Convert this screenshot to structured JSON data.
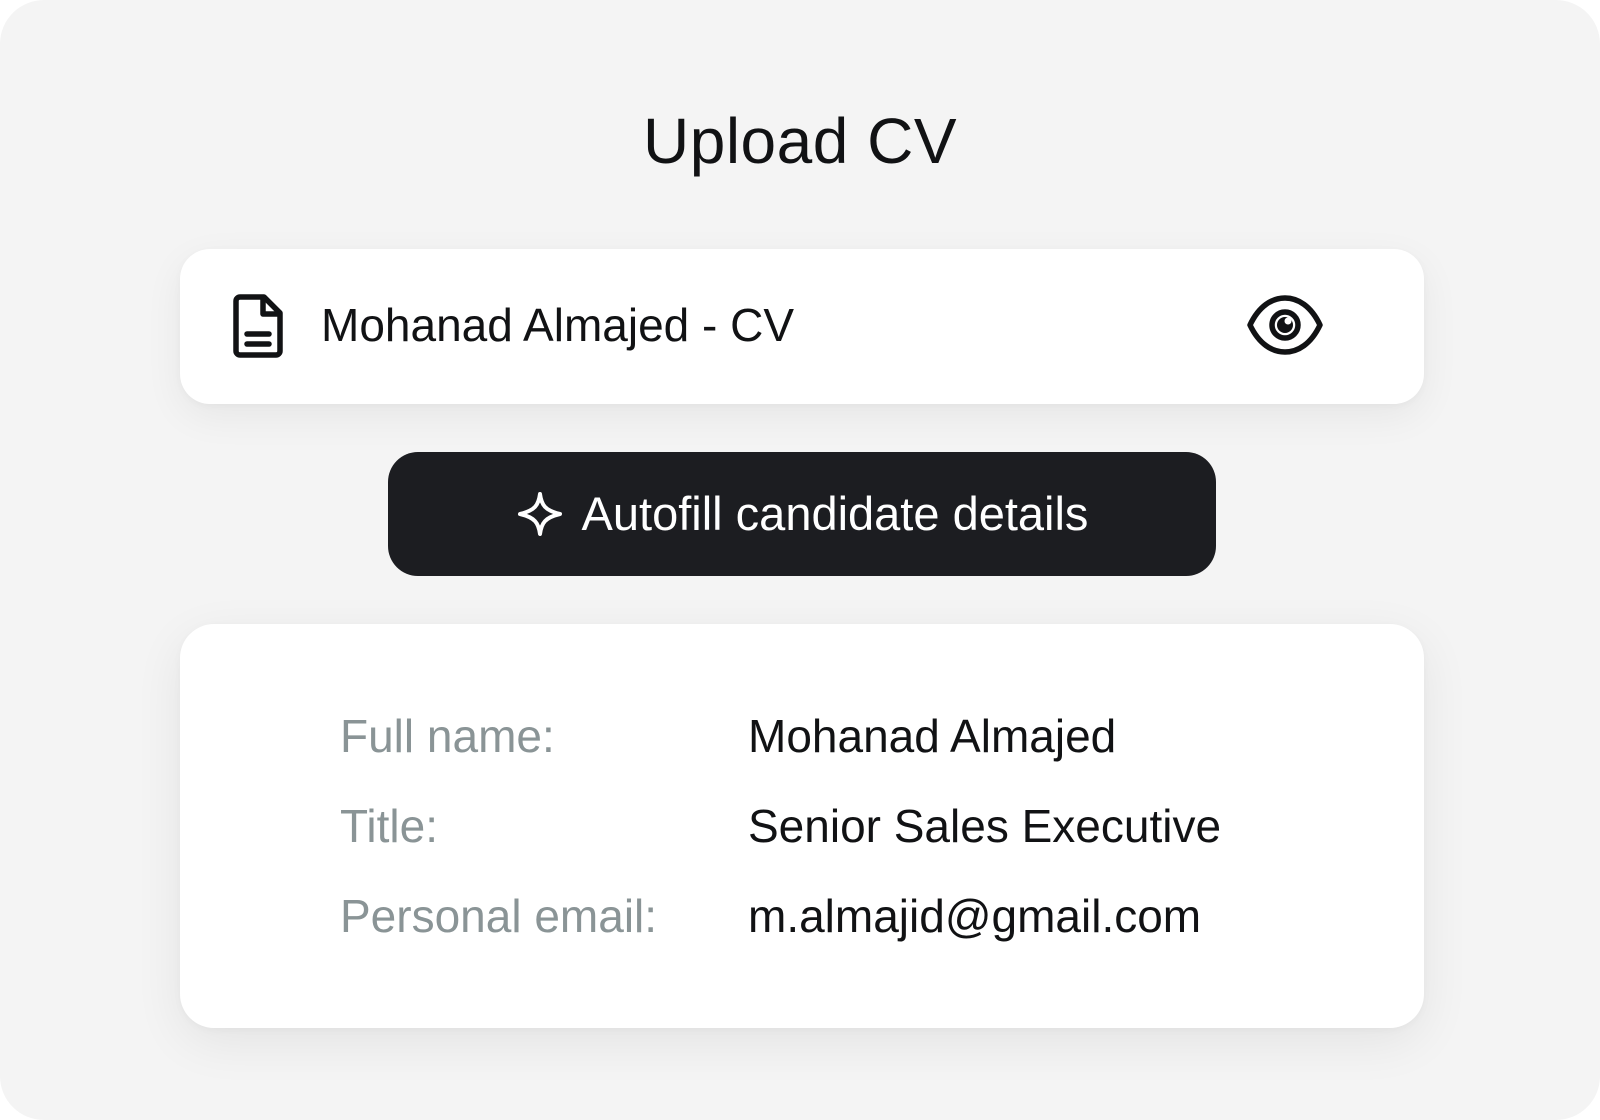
{
  "page": {
    "title": "Upload CV"
  },
  "file": {
    "icon": "document-icon",
    "name": "Mohanad Almajed - CV",
    "preview_icon": "eye-icon"
  },
  "autofill": {
    "icon": "sparkle-icon",
    "label": "Autofill candidate details"
  },
  "details": {
    "rows": [
      {
        "label": "Full name:",
        "value": "Mohanad Almajed"
      },
      {
        "label": "Title:",
        "value": "Senior Sales Executive"
      },
      {
        "label": "Personal email:",
        "value": "m.almajid@gmail.com"
      }
    ]
  },
  "colors": {
    "background": "#f4f4f4",
    "card": "#ffffff",
    "button": "#1c1d21",
    "label": "#8a9496",
    "text": "#111214"
  }
}
